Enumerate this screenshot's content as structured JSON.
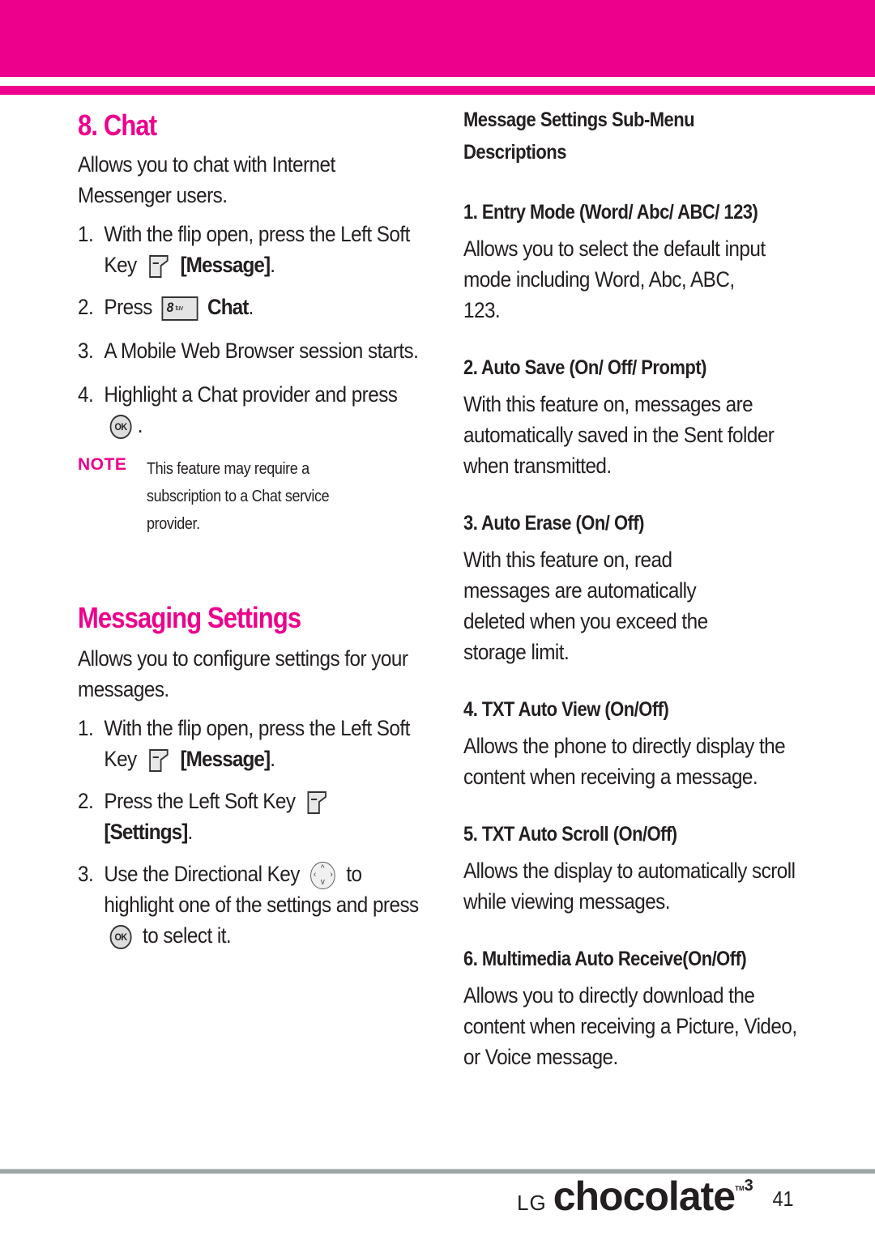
{
  "colors": {
    "accent": "#ec008c",
    "text": "#231f20",
    "footer_rule": "#9da5a5"
  },
  "chat": {
    "title": "8. Chat",
    "intro": "Allows you to chat with Internet Messenger users.",
    "steps": [
      {
        "num": "1.",
        "text_before": "With the flip open, press the Left Soft Key",
        "icon": "left-soft-key-icon",
        "bold": "[Message]",
        "text_after": "."
      },
      {
        "num": "2.",
        "text_before": "Press",
        "icon": "key-8-tuv-icon",
        "key_digit": "8",
        "key_letters": "tuv",
        "bold": "Chat",
        "text_after": "."
      },
      {
        "num": "3.",
        "text_before": "A Mobile Web Browser session starts."
      },
      {
        "num": "4.",
        "text_before": "Highlight a Chat provider and press",
        "icon": "ok-key-icon",
        "text_after": "."
      }
    ],
    "note_label": "NOTE",
    "note_text": "This feature may require a subscription to a Chat service provider."
  },
  "messaging_settings": {
    "title": "Messaging Settings",
    "intro": "Allows you to configure settings for your messages.",
    "steps": [
      {
        "num": "1.",
        "text_before": "With the flip open, press the Left Soft Key",
        "icon": "left-soft-key-icon",
        "bold": "[Message]",
        "text_after": "."
      },
      {
        "num": "2.",
        "text_before": "Press the Left Soft Key",
        "icon": "left-soft-key-icon",
        "bold": "[Settings]",
        "text_after": "."
      },
      {
        "num": "3.",
        "text_before": "Use the Directional Key",
        "icon": "directional-key-icon",
        "text_middle": "to highlight one of the settings and press",
        "icon2": "ok-key-icon",
        "text_after": "to select it."
      }
    ]
  },
  "submenu": {
    "heading": "Message Settings Sub-Menu Descriptions",
    "items": [
      {
        "title": "1. Entry Mode (Word/ Abc/ ABC/ 123)",
        "desc": "Allows you to select the default input mode including Word, Abc, ABC, 123."
      },
      {
        "title": "2. Auto Save (On/ Off/ Prompt)",
        "desc": "With this feature on, messages are automatically saved in the Sent folder when transmitted."
      },
      {
        "title": "3. Auto Erase (On/ Off)",
        "desc": "With this feature on, read messages are automatically deleted when you exceed the storage limit."
      },
      {
        "title": "4. TXT Auto View (On/Off)",
        "desc": "Allows the phone to directly display the content when receiving a message."
      },
      {
        "title": "5. TXT Auto Scroll (On/Off)",
        "desc": "Allows the display to automatically scroll while viewing messages."
      },
      {
        "title": "6. Multimedia Auto Receive(On/Off)",
        "desc": "Allows you to directly download the content when receiving a Picture, Video, or Voice message."
      }
    ]
  },
  "footer": {
    "brand_lg": "LG",
    "brand_name": "chocolate",
    "brand_tm": "TM",
    "brand_version": "3",
    "page_number": "41"
  }
}
